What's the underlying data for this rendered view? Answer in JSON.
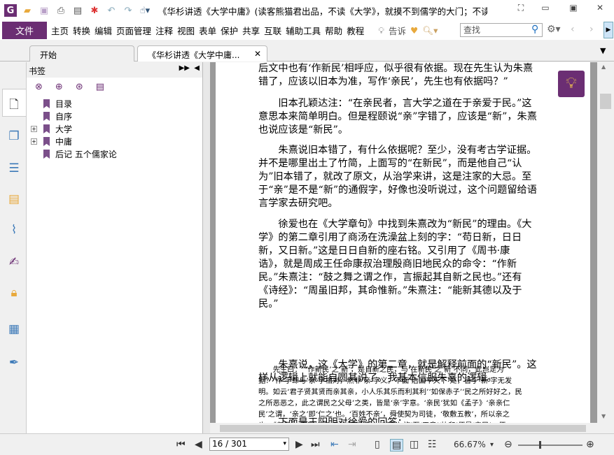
{
  "window": {
    "title": "《华杉讲透《大学中庸》(读客熊猫君出品，不读《大学》，就摸不到儒学的大门；不读..."
  },
  "menu": {
    "file": "文件",
    "items": [
      "主页",
      "转换",
      "编辑",
      "页面管理",
      "注释",
      "视图",
      "表单",
      "保护",
      "共享",
      "互联",
      "辅助工具",
      "帮助",
      "教程"
    ],
    "tell": "告诉",
    "search_placeholder": "查找"
  },
  "tabs": [
    {
      "label": "开始"
    },
    {
      "label": "《华杉讲透《大学中庸..."
    }
  ],
  "bookmarks": {
    "title": "书签",
    "items": [
      {
        "label": "目录",
        "expandable": false
      },
      {
        "label": "自序",
        "expandable": false
      },
      {
        "label": "大学",
        "expandable": true
      },
      {
        "label": "中庸",
        "expandable": true
      },
      {
        "label": "后记 五个儒家论",
        "expandable": false
      }
    ]
  },
  "document": {
    "paragraphs": [
      [
        "后文中也有‘作新民’相呼应，似乎很有依据。现在先生认为朱熹",
        "错了，应该以旧本为准，写作‘亲民’，先生也有依据吗？”"
      ],
      [
        "　　旧本孔颖达注：“在亲民者，言大学之道在于亲爱于民。”这",
        "意思本来简单明白。但是程颐说“亲”字错了，应该是“新”，朱熹",
        "也说应该是“新民”。"
      ],
      [
        "　　朱熹说旧本错了，有什么依据呢？至少，没有考古学证据。",
        "并不是哪里出土了竹简，上面写的“在新民”，而是他自己“认",
        "为”旧本错了，就改了原文，从治学来讲，这是注家的大忌。至",
        "于“亲”是不是“新”的通假字，好像也没听说过，这个问题留给语",
        "言学家去研究吧。"
      ],
      [
        "　　徐爱也在《大学章句》中找到朱熹改为“新民”的理由。《大",
        "学》的第二章引用了商汤在洗澡盆上刻的字：“苟日新，日日",
        "新，又日新。”这是日日自新的座右铭。又引用了《周书·康",
        "诰》，就是周成王任命康叔治理殷商旧地民众的命令：“作新",
        "民。”朱熹注：“鼓之舞之谓之作，言振起其自新之民也。”还有",
        "《诗经》：“周虽旧邦，其命惟新。”朱熹注：“能新其德以及于",
        "民。”"
      ],
      [
        "　　朱熹说，这《大学》的第二章，就是解释前面的“新民”。这",
        "样从逻辑上就能自圆其说了。我基本信服朱熹的逻辑。"
      ],
      [
        "　　下面是王阳明对徐爱的回答："
      ]
    ],
    "quote": [
      "　　先生曰：“‘作新民’之‘新’，是自新之民，与‘在新民’之‘新’不同，此岂足为",
      "据？‘作’字却与‘亲’字相对，然非‘亲’字义。下面‘治国平天下’处，皆于‘新’字无发",
      "明。如云‘君子贤其贤而亲其亲，小人乐其乐而利其利’‘如保赤子’‘民之所好好之，民",
      "之所恶恶之，此之谓民之父母’之类，皆是‘亲’字意。‘亲民’犹如《孟子》‘亲亲仁",
      "民’之谓，‘亲之’即‘仁之’也。‘百姓不亲’，舜使契为司徒，‘敬敷五教’，所以亲之",
      "也。《尧典》‘克明峻德’便是‘明明德’，‘以亲九族’至‘平章’‘协和’便是‘亲民’，便"
    ]
  },
  "status": {
    "page": "16 / 301",
    "zoom": "66.67%"
  }
}
